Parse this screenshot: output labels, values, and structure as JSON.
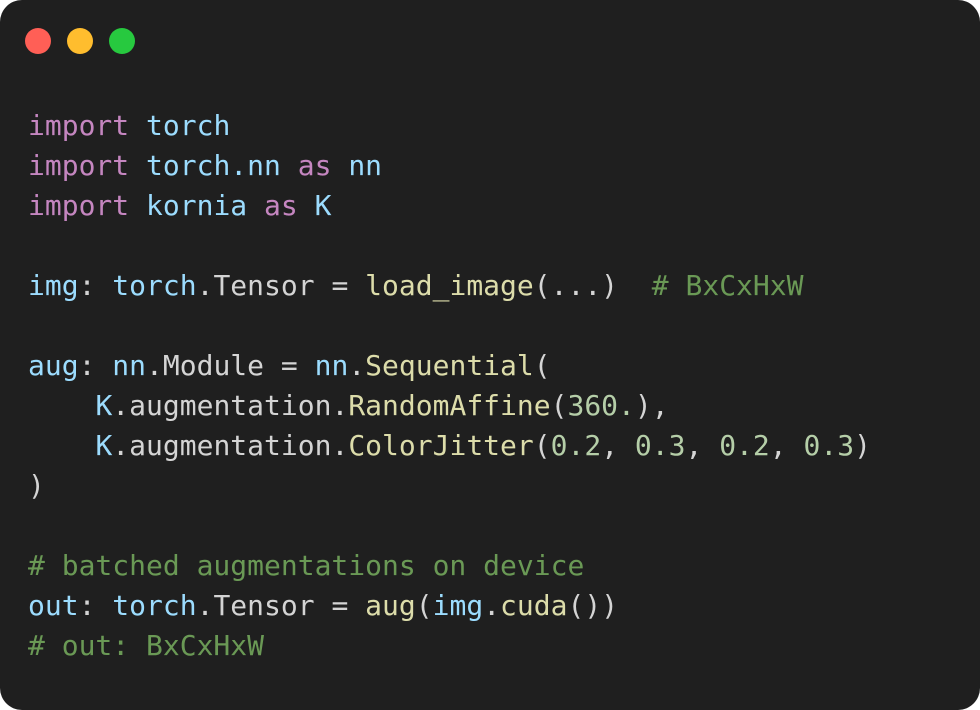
{
  "window": {
    "traffic_lights": [
      {
        "name": "close",
        "color": "#ff5f56"
      },
      {
        "name": "minimize",
        "color": "#ffbd2e"
      },
      {
        "name": "maximize",
        "color": "#27c93f"
      }
    ]
  },
  "code": {
    "lines": [
      [
        {
          "t": "import",
          "c": "kw"
        },
        {
          "t": " ",
          "c": "op"
        },
        {
          "t": "torch",
          "c": "mod"
        }
      ],
      [
        {
          "t": "import",
          "c": "kw"
        },
        {
          "t": " ",
          "c": "op"
        },
        {
          "t": "torch.nn",
          "c": "mod"
        },
        {
          "t": " ",
          "c": "op"
        },
        {
          "t": "as",
          "c": "kw"
        },
        {
          "t": " ",
          "c": "op"
        },
        {
          "t": "nn",
          "c": "mod"
        }
      ],
      [
        {
          "t": "import",
          "c": "kw"
        },
        {
          "t": " ",
          "c": "op"
        },
        {
          "t": "kornia",
          "c": "mod"
        },
        {
          "t": " ",
          "c": "op"
        },
        {
          "t": "as",
          "c": "kw"
        },
        {
          "t": " ",
          "c": "op"
        },
        {
          "t": "K",
          "c": "mod"
        }
      ],
      [],
      [
        {
          "t": "img",
          "c": "mod"
        },
        {
          "t": ": ",
          "c": "op"
        },
        {
          "t": "torch",
          "c": "mod"
        },
        {
          "t": ".Tensor = ",
          "c": "op"
        },
        {
          "t": "load_image",
          "c": "fn"
        },
        {
          "t": "(...)  ",
          "c": "op"
        },
        {
          "t": "# BxCxHxW",
          "c": "cm"
        }
      ],
      [],
      [
        {
          "t": "aug",
          "c": "mod"
        },
        {
          "t": ": ",
          "c": "op"
        },
        {
          "t": "nn",
          "c": "mod"
        },
        {
          "t": ".Module = ",
          "c": "op"
        },
        {
          "t": "nn",
          "c": "mod"
        },
        {
          "t": ".",
          "c": "op"
        },
        {
          "t": "Sequential",
          "c": "fn"
        },
        {
          "t": "(",
          "c": "op"
        }
      ],
      [
        {
          "t": "    ",
          "c": "op"
        },
        {
          "t": "K",
          "c": "mod"
        },
        {
          "t": ".augmentation.",
          "c": "op"
        },
        {
          "t": "RandomAffine",
          "c": "fn"
        },
        {
          "t": "(",
          "c": "op"
        },
        {
          "t": "360.",
          "c": "num"
        },
        {
          "t": "),",
          "c": "op"
        }
      ],
      [
        {
          "t": "    ",
          "c": "op"
        },
        {
          "t": "K",
          "c": "mod"
        },
        {
          "t": ".augmentation.",
          "c": "op"
        },
        {
          "t": "ColorJitter",
          "c": "fn"
        },
        {
          "t": "(",
          "c": "op"
        },
        {
          "t": "0.2",
          "c": "num"
        },
        {
          "t": ", ",
          "c": "op"
        },
        {
          "t": "0.3",
          "c": "num"
        },
        {
          "t": ", ",
          "c": "op"
        },
        {
          "t": "0.2",
          "c": "num"
        },
        {
          "t": ", ",
          "c": "op"
        },
        {
          "t": "0.3",
          "c": "num"
        },
        {
          "t": ")",
          "c": "op"
        }
      ],
      [
        {
          "t": ")",
          "c": "op"
        }
      ],
      [],
      [
        {
          "t": "# batched augmentations on device",
          "c": "cm"
        }
      ],
      [
        {
          "t": "out",
          "c": "mod"
        },
        {
          "t": ": ",
          "c": "op"
        },
        {
          "t": "torch",
          "c": "mod"
        },
        {
          "t": ".Tensor = ",
          "c": "op"
        },
        {
          "t": "aug",
          "c": "fn"
        },
        {
          "t": "(",
          "c": "op"
        },
        {
          "t": "img",
          "c": "mod"
        },
        {
          "t": ".",
          "c": "op"
        },
        {
          "t": "cuda",
          "c": "fn"
        },
        {
          "t": "())",
          "c": "op"
        }
      ],
      [
        {
          "t": "# out: BxCxHxW",
          "c": "cm"
        }
      ]
    ]
  }
}
